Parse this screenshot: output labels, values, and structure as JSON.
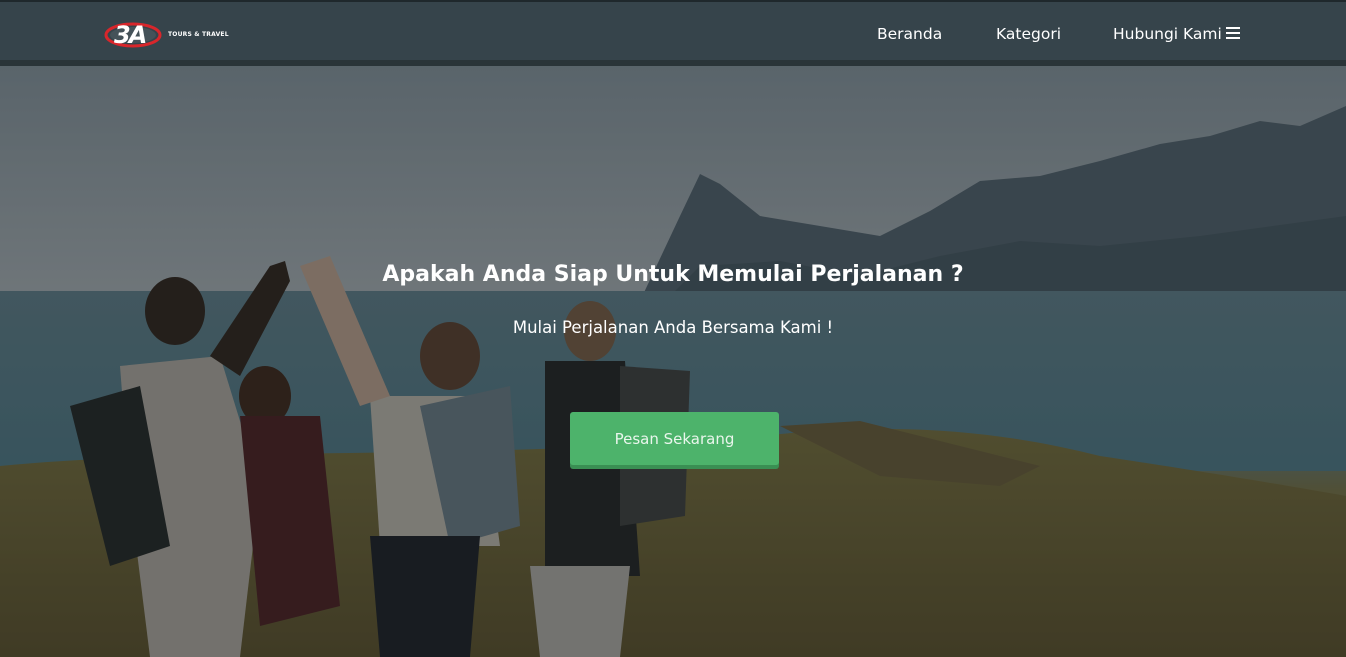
{
  "brand": {
    "logo_mark": "3A",
    "tagline": "TOURS & TRAVEL"
  },
  "nav": {
    "items": [
      {
        "label": "Beranda"
      },
      {
        "label": "Kategori"
      },
      {
        "label": "Hubungi Kami"
      }
    ],
    "menu_icon": "hamburger-menu-icon"
  },
  "hero": {
    "title": "Apakah Anda Siap Untuk Memulai Perjalanan ?",
    "subtitle": "Mulai Perjalanan Anda Bersama Kami !",
    "cta_label": "Pesan Sekarang"
  },
  "colors": {
    "navbar": "#36444b",
    "cta": "#4db36b",
    "logo_red": "#d8262b"
  }
}
